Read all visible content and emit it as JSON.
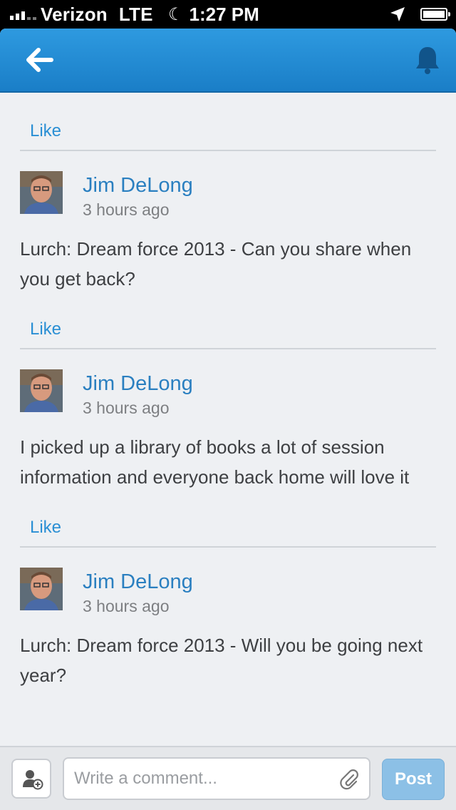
{
  "status_bar": {
    "carrier": "Verizon",
    "network": "LTE",
    "time": "1:27 PM",
    "signal_bars": 3,
    "battery_level": 1.0
  },
  "navbar": {
    "back_icon": "back-arrow-icon",
    "notification_icon": "bell-icon",
    "color": "#1f8ad4"
  },
  "feed": {
    "like_label": "Like",
    "comments": [
      {
        "author": "Jim DeLong",
        "time": "3 hours ago",
        "text": "Lurch: Dream force 2013 - Can you share when you get back?"
      },
      {
        "author": "Jim DeLong",
        "time": "3 hours ago",
        "text": "I picked up a library of books a lot of session information and everyone back home will love it"
      },
      {
        "author": "Jim DeLong",
        "time": "3 hours ago",
        "text": "Lurch: Dream force 2013 - Will you be going next year?"
      }
    ]
  },
  "composer": {
    "placeholder": "Write a comment...",
    "post_label": "Post",
    "mention_icon": "add-person-icon",
    "attach_icon": "paperclip-icon"
  },
  "colors": {
    "link": "#2a8fd4",
    "author": "#2a7fc0",
    "post_button": "#8cc0e6"
  }
}
